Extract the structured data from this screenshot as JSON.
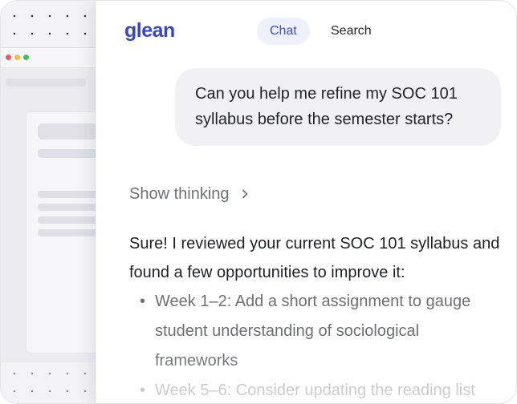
{
  "brand": {
    "logo_text": "glean"
  },
  "tabs": [
    {
      "label": "Chat",
      "active": true
    },
    {
      "label": "Search",
      "active": false
    }
  ],
  "user_message": {
    "text": "Can you help me refine my SOC 101 syllabus before the semester starts?"
  },
  "thinking": {
    "label": "Show thinking",
    "icon": "chevron-right-icon"
  },
  "response": {
    "intro": "Sure! I reviewed your current SOC 101 syllabus and found a few opportunities to improve it:",
    "bullets": [
      "Week 1–2: Add a short assignment to gauge student understanding of sociological frameworks",
      "Week 5–6: Consider updating the reading list"
    ]
  },
  "colors": {
    "brand": "#3445d8",
    "active_tab_bg": "#eef0fc",
    "bubble_bg": "#f1f1f3"
  }
}
